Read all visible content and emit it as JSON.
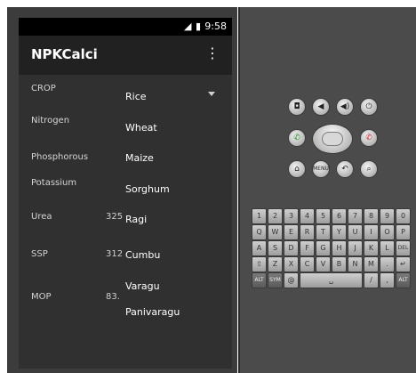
{
  "statusbar": {
    "time": "9:58",
    "icons": [
      "signal-icon",
      "battery-icon"
    ]
  },
  "app": {
    "title": "NPKCalci",
    "menu_icon": "more-vert-icon"
  },
  "form": {
    "crop_label": "CROP",
    "nitrogen_label": "Nitrogen",
    "phosphorous_label": "Phosphorous",
    "potassium_label": "Potassium",
    "urea_label": "Urea",
    "urea_value": "325",
    "ssp_label": "SSP",
    "ssp_value": "312",
    "mop_label": "MOP",
    "mop_value": "83."
  },
  "dropdown": {
    "selected": "Rice",
    "items": [
      "Rice",
      "Wheat",
      "Maize",
      "Sorghum",
      "Ragi",
      "Cumbu",
      "Varagu",
      "Panivaragu"
    ]
  },
  "emulator": {
    "buttons": [
      "camera-icon",
      "volume-down-icon",
      "volume-up-icon",
      "power-icon",
      "call-icon",
      "end-call-icon",
      "home-icon",
      "menu-icon",
      "back-icon",
      "search-icon"
    ],
    "keyboard_rows": [
      [
        "1",
        "2",
        "3",
        "4",
        "5",
        "6",
        "7",
        "8",
        "9",
        "0"
      ],
      [
        "Q",
        "W",
        "E",
        "R",
        "T",
        "Y",
        "U",
        "I",
        "O",
        "P"
      ],
      [
        "A",
        "S",
        "D",
        "F",
        "G",
        "H",
        "J",
        "K",
        "L",
        "DEL"
      ],
      [
        "⇧",
        "Z",
        "X",
        "C",
        "V",
        "B",
        "N",
        "M",
        ".",
        "↵"
      ],
      [
        "ALT",
        "SYM",
        "@",
        "␣",
        "/",
        "?",
        ",",
        "ALT"
      ]
    ],
    "menu_button_label": "MENU"
  }
}
